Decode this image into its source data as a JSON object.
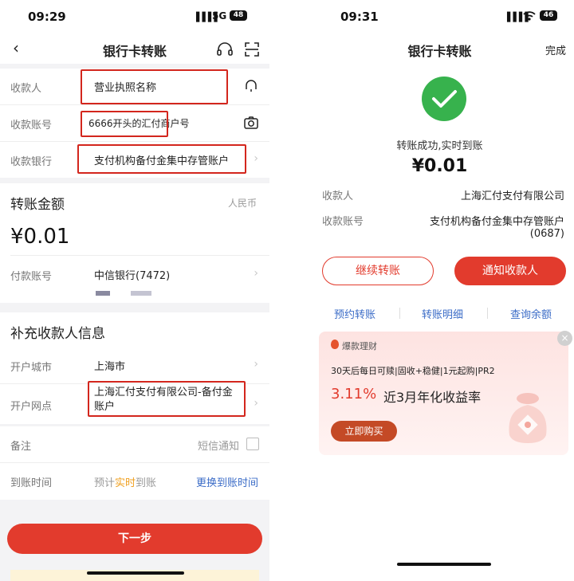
{
  "left": {
    "status": {
      "time": "09:29",
      "network": "5G",
      "battery": "48"
    },
    "nav": {
      "title": "银行卡转账"
    },
    "payee": {
      "name_label": "收款人",
      "name_value": "营业执照名称",
      "account_label": "收款账号",
      "account_value": "6666开头的汇付商户号",
      "bank_label": "收款银行",
      "bank_value": "支付机构备付金集中存管账户"
    },
    "amount": {
      "section_title": "转账金额",
      "currency": "人民币",
      "value": "¥0.01",
      "pay_account_label": "付款账号",
      "pay_account_value": "中信银行(7472)"
    },
    "supplement": {
      "section_title": "补充收款人信息",
      "city_label": "开户城市",
      "city_value": "上海市",
      "branch_label": "开户网点",
      "branch_value": "上海汇付支付有限公司-备付金账户"
    },
    "remark": {
      "label": "备注",
      "sms_label": "短信通知"
    },
    "arrival": {
      "label": "到账时间",
      "prefix": "预计",
      "highlight": "实时",
      "suffix": "到账",
      "change_link": "更换到账时间"
    },
    "next_button": "下一步"
  },
  "right": {
    "status": {
      "time": "09:31",
      "battery": "46"
    },
    "nav": {
      "title": "银行卡转账",
      "done": "完成"
    },
    "result": {
      "message": "转账成功,实时到账",
      "amount": "¥0.01"
    },
    "details": {
      "payee_label": "收款人",
      "payee_value": "上海汇付支付有限公司",
      "account_label": "收款账号",
      "account_value_line1": "支付机构备付金集中存管账户",
      "account_value_line2": "(0687)"
    },
    "buttons": {
      "continue": "继续转账",
      "notify": "通知收款人"
    },
    "links": {
      "schedule": "预约转账",
      "detail": "转账明细",
      "balance": "查询余额"
    },
    "ad": {
      "brand": "爆款理财",
      "features": "30天后每日可赎|固收+稳健|1元起购|PR2",
      "rate": "3.11%",
      "rate_desc": "近3月年化收益率",
      "cta": "立即购买"
    }
  },
  "colors": {
    "accent_red": "#e23b2d",
    "box_red": "#d3261d",
    "link_blue": "#3b6cc7",
    "success_green": "#37b24d"
  }
}
